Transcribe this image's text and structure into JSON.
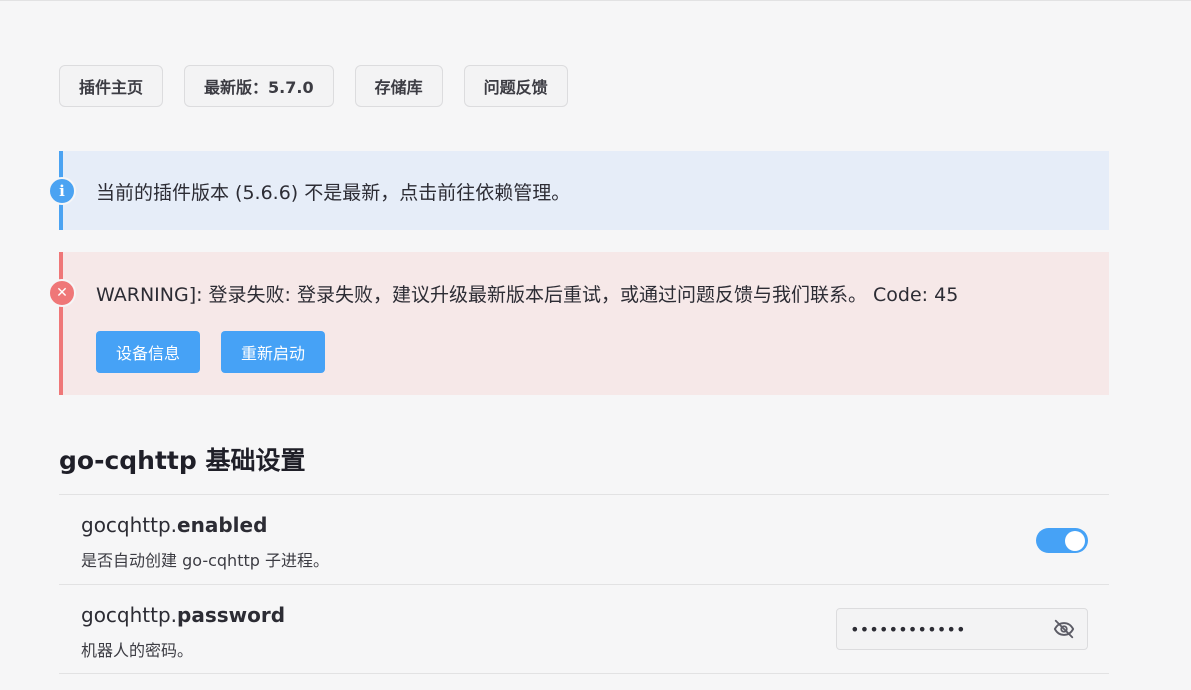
{
  "links": {
    "home": "插件主页",
    "latest": "最新版：5.7.0",
    "repo": "存储库",
    "feedback": "问题反馈"
  },
  "info_notice": {
    "icon": "info-icon",
    "text": "当前的插件版本 (5.6.6) 不是最新，点击前往依赖管理。",
    "color": "#4ba3f2"
  },
  "error_notice": {
    "icon": "error-icon",
    "text": "WARNING]: 登录失败: 登录失败，建议升级最新版本后重试，或通过问题反馈与我们联系。 Code: 45",
    "color": "#ef7778",
    "device_info_button": "设备信息",
    "restart_button": "重新启动"
  },
  "section": {
    "title": "go-cqhttp 基础设置"
  },
  "settings": {
    "enabled": {
      "prefix": "gocqhttp.",
      "key": "enabled",
      "description": "是否自动创建 go-cqhttp 子进程。",
      "value": true
    },
    "password": {
      "prefix": "gocqhttp.",
      "key": "password",
      "description": "机器人的密码。",
      "masked_value": "••••••••••••",
      "toggle_icon": "eye-off-icon"
    }
  },
  "colors": {
    "accent": "#46a2f6",
    "background": "#f6f6f7"
  }
}
